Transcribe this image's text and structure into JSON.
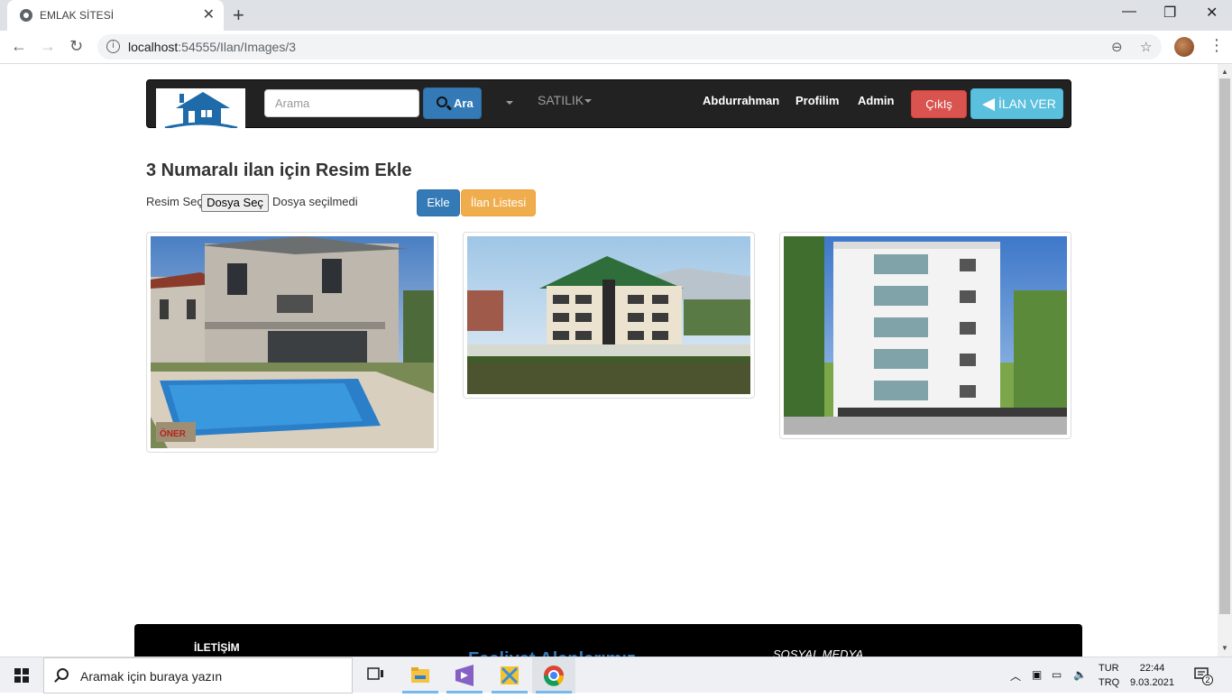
{
  "browser": {
    "tab_title": "EMLAK SİTESİ",
    "url_host": "localhost",
    "url_path": ":54555/Ilan/Images/3"
  },
  "navbar": {
    "search_placeholder": "Arama",
    "search_button": "Ara",
    "dropdown_satilik": "SATILIK",
    "user_link": "Abdurrahman",
    "profile_link": "Profilim",
    "admin_link": "Admin",
    "logout_button": "ÇıkIş",
    "post_ad_button": "İLAN VER"
  },
  "page": {
    "heading": "3 Numaralı ilan için Resim Ekle",
    "file_label": "Resim Seç",
    "file_button": "Dosya Seç",
    "file_status": "Dosya seçilmedi",
    "add_button": "Ekle",
    "list_button": "İlan Listesi"
  },
  "images": [
    {
      "alt": "villa with pool",
      "watermark": "ÖNER"
    },
    {
      "alt": "apartment building green roof"
    },
    {
      "alt": "white apartment building render"
    }
  ],
  "footer": {
    "contact_title": "İLETİŞİM",
    "center_title": "Faaliyet Alanlarımız",
    "social_title": "SOSYAL MEDYA"
  },
  "taskbar": {
    "search_placeholder": "Aramak için buraya yazın",
    "lang_top": "TUR",
    "lang_bottom": "TRQ",
    "time": "22:44",
    "date": "9.03.2021",
    "notification_count": "2"
  },
  "colors": {
    "primary": "#337ab7",
    "danger": "#d9534f",
    "info": "#5bc0de",
    "warning": "#f0ad4e",
    "navbar_bg": "#222222"
  }
}
